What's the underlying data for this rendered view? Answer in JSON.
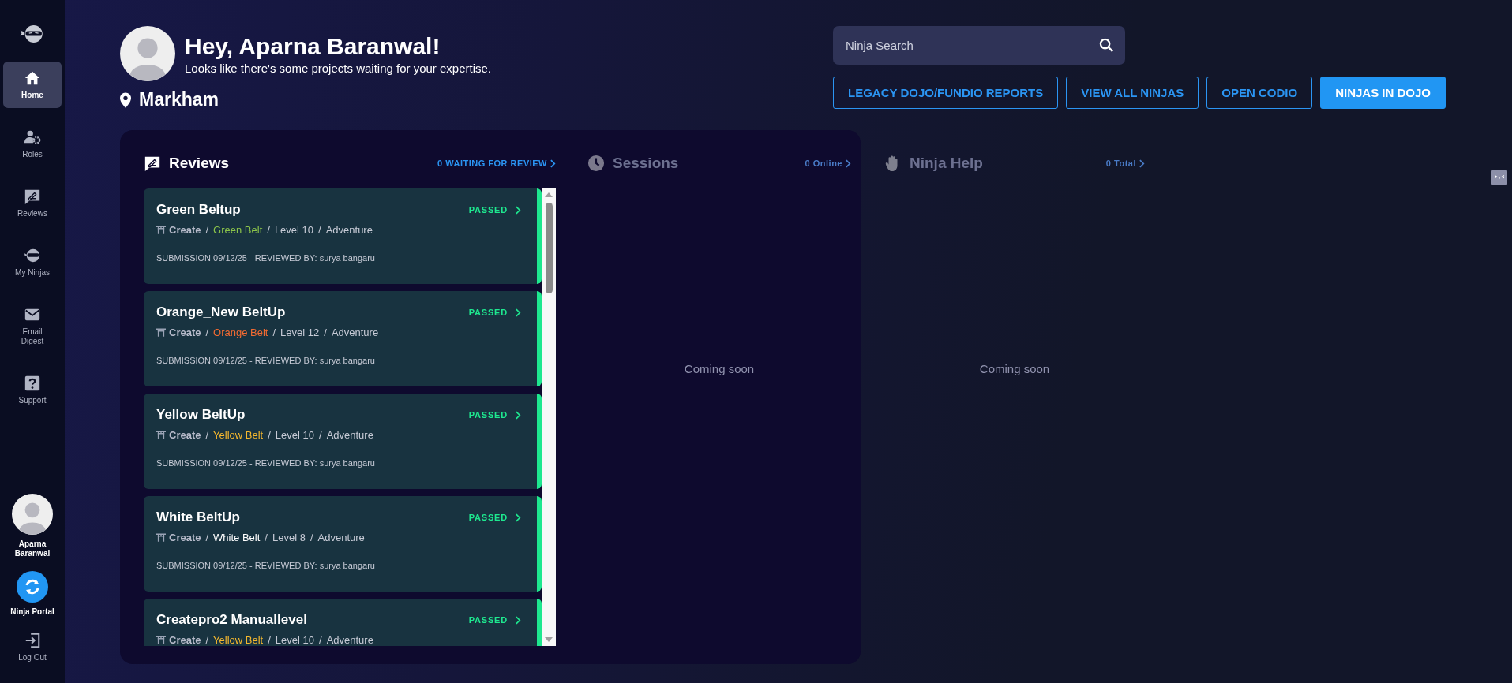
{
  "sidebar": {
    "items": [
      {
        "kind": "home",
        "label": "Home",
        "selected": true
      },
      {
        "kind": "roles",
        "label": "Roles",
        "selected": false
      },
      {
        "kind": "reviews",
        "label": "Reviews",
        "selected": false
      },
      {
        "kind": "ninjas",
        "label": "My Ninjas",
        "selected": false
      },
      {
        "kind": "email",
        "label": "Email Digest",
        "selected": false
      },
      {
        "kind": "support",
        "label": "Support",
        "selected": false
      }
    ],
    "user": {
      "name": "Aparna Baranwal"
    },
    "portal": {
      "label": "Ninja Portal"
    },
    "logout": {
      "label": "Log Out"
    }
  },
  "header": {
    "greeting": "Hey, Aparna Baranwal!",
    "subtitle": "Looks like there's some projects waiting for your expertise.",
    "location": "Markham"
  },
  "search": {
    "placeholder": "Ninja Search"
  },
  "buttons": [
    {
      "label": "LEGACY DOJO/FUNDIO REPORTS",
      "primary": false
    },
    {
      "label": "VIEW ALL NINJAS",
      "primary": false
    },
    {
      "label": "OPEN CODIO",
      "primary": false
    },
    {
      "label": "NINJAS IN DOJO",
      "primary": true
    }
  ],
  "sections": [
    {
      "kind": "reviews",
      "title": "Reviews",
      "link": "0 WAITING FOR REVIEW",
      "disabled": false,
      "reviews": [
        {
          "title": "Green Beltup",
          "status": "PASSED",
          "path": [
            {
              "kind": "category",
              "text": "Create"
            },
            {
              "kind": "sep",
              "text": "/"
            },
            {
              "kind": "belt",
              "text": "Green Belt",
              "color": "#8bc34a"
            },
            {
              "kind": "sep",
              "text": "/"
            },
            {
              "kind": "plain",
              "text": "Level 10"
            },
            {
              "kind": "sep",
              "text": "/"
            },
            {
              "kind": "plain",
              "text": "Adventure"
            }
          ],
          "submission": "SUBMISSION 09/12/25 - REVIEWED BY: surya bangaru"
        },
        {
          "title": "Orange_New BeltUp",
          "status": "PASSED",
          "path": [
            {
              "kind": "category",
              "text": "Create"
            },
            {
              "kind": "sep",
              "text": "/"
            },
            {
              "kind": "belt",
              "text": "Orange Belt",
              "color": "#f26b32"
            },
            {
              "kind": "sep",
              "text": "/"
            },
            {
              "kind": "plain",
              "text": "Level 12"
            },
            {
              "kind": "sep",
              "text": "/"
            },
            {
              "kind": "plain",
              "text": "Adventure"
            }
          ],
          "submission": "SUBMISSION 09/12/25 - REVIEWED BY: surya bangaru"
        },
        {
          "title": "Yellow BeltUp",
          "status": "PASSED",
          "path": [
            {
              "kind": "category",
              "text": "Create"
            },
            {
              "kind": "sep",
              "text": "/"
            },
            {
              "kind": "belt",
              "text": "Yellow Belt",
              "color": "#f5b82e"
            },
            {
              "kind": "sep",
              "text": "/"
            },
            {
              "kind": "plain",
              "text": "Level 10"
            },
            {
              "kind": "sep",
              "text": "/"
            },
            {
              "kind": "plain",
              "text": "Adventure"
            }
          ],
          "submission": "SUBMISSION 09/12/25 - REVIEWED BY: surya bangaru"
        },
        {
          "title": "White BeltUp",
          "status": "PASSED",
          "path": [
            {
              "kind": "category",
              "text": "Create"
            },
            {
              "kind": "sep",
              "text": "/"
            },
            {
              "kind": "belt",
              "text": "White Belt",
              "color": "#ffffff"
            },
            {
              "kind": "sep",
              "text": "/"
            },
            {
              "kind": "plain",
              "text": "Level 8"
            },
            {
              "kind": "sep",
              "text": "/"
            },
            {
              "kind": "plain",
              "text": "Adventure"
            }
          ],
          "submission": "SUBMISSION 09/12/25 - REVIEWED BY: surya bangaru"
        },
        {
          "title": "Createpro2 Manuallevel",
          "status": "PASSED",
          "path": [
            {
              "kind": "category",
              "text": "Create"
            },
            {
              "kind": "sep",
              "text": "/"
            },
            {
              "kind": "belt",
              "text": "Yellow Belt",
              "color": "#f5b82e"
            },
            {
              "kind": "sep",
              "text": "/"
            },
            {
              "kind": "plain",
              "text": "Level 10"
            },
            {
              "kind": "sep",
              "text": "/"
            },
            {
              "kind": "plain",
              "text": "Adventure"
            }
          ]
        }
      ]
    },
    {
      "kind": "sessions",
      "title": "Sessions",
      "link": "0 Online",
      "disabled": true,
      "message": "Coming soon"
    },
    {
      "kind": "help",
      "title": "Ninja Help",
      "link": "0 Total",
      "disabled": true,
      "message": "Coming soon"
    }
  ]
}
